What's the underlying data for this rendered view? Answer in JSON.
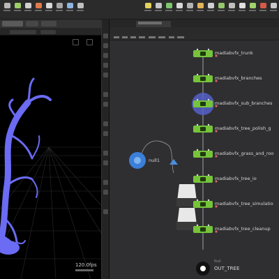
{
  "colors": {
    "node_fill": "#76c43a",
    "branch_color": "#6b6bf4",
    "null_node": "#3b7fd9",
    "out_node": "#ffffff",
    "background_net": "#2f2f32"
  },
  "viewport": {
    "fps_readout": "120.0fps"
  },
  "network": {
    "nodes": [
      {
        "name": "madiabvfx_trunk",
        "icon": "subnet-node-icon"
      },
      {
        "name": "madiabvfx_branches",
        "icon": "subnet-node-icon"
      },
      {
        "name": "madiabvfx_sub_branches",
        "icon": "subnet-node-icon"
      },
      {
        "name": "madiabvfx_tree_polish_g",
        "icon": "subnet-node-icon"
      },
      {
        "name": "madiabvfx_grass_and_roo",
        "icon": "subnet-node-icon"
      },
      {
        "name": "madiabvfx_tree_io",
        "icon": "subnet-node-icon"
      },
      {
        "name": "madiabvfx_tree_simulatio",
        "icon": "subnet-node-icon"
      },
      {
        "name": "madiabvfx_tree_cleanup",
        "icon": "subnet-node-icon"
      }
    ],
    "null_node": {
      "name": "null1"
    },
    "out_node": {
      "label": "OUT_TREE",
      "tag": "Null"
    }
  }
}
